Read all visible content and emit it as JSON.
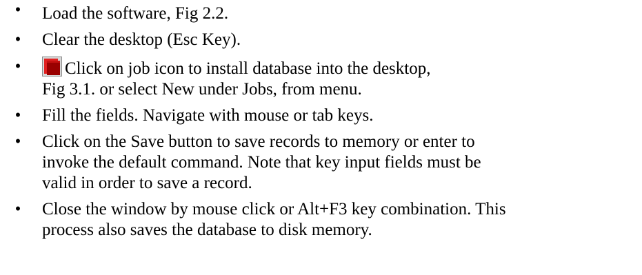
{
  "bullet_glyph": "•",
  "items": [
    {
      "lines": [
        "Load the software, Fig 2.2."
      ]
    },
    {
      "lines": [
        "Clear the desktop (Esc Key)."
      ]
    },
    {
      "icon": "job-icon",
      "lines": [
        "Click on job icon to install database into the desktop,",
        "Fig 3.1. or select New under Jobs, from menu."
      ]
    },
    {
      "lines": [
        "Fill the fields. Navigate with mouse or tab keys."
      ]
    },
    {
      "lines": [
        "Click on the Save button to save records to memory or enter to",
        "invoke the default command. Note that key input fields must be",
        "valid in order to save a record."
      ]
    },
    {
      "lines": [
        "Close the window by mouse click or Alt+F3 key combination. This",
        "process also saves the database to disk memory."
      ]
    }
  ]
}
